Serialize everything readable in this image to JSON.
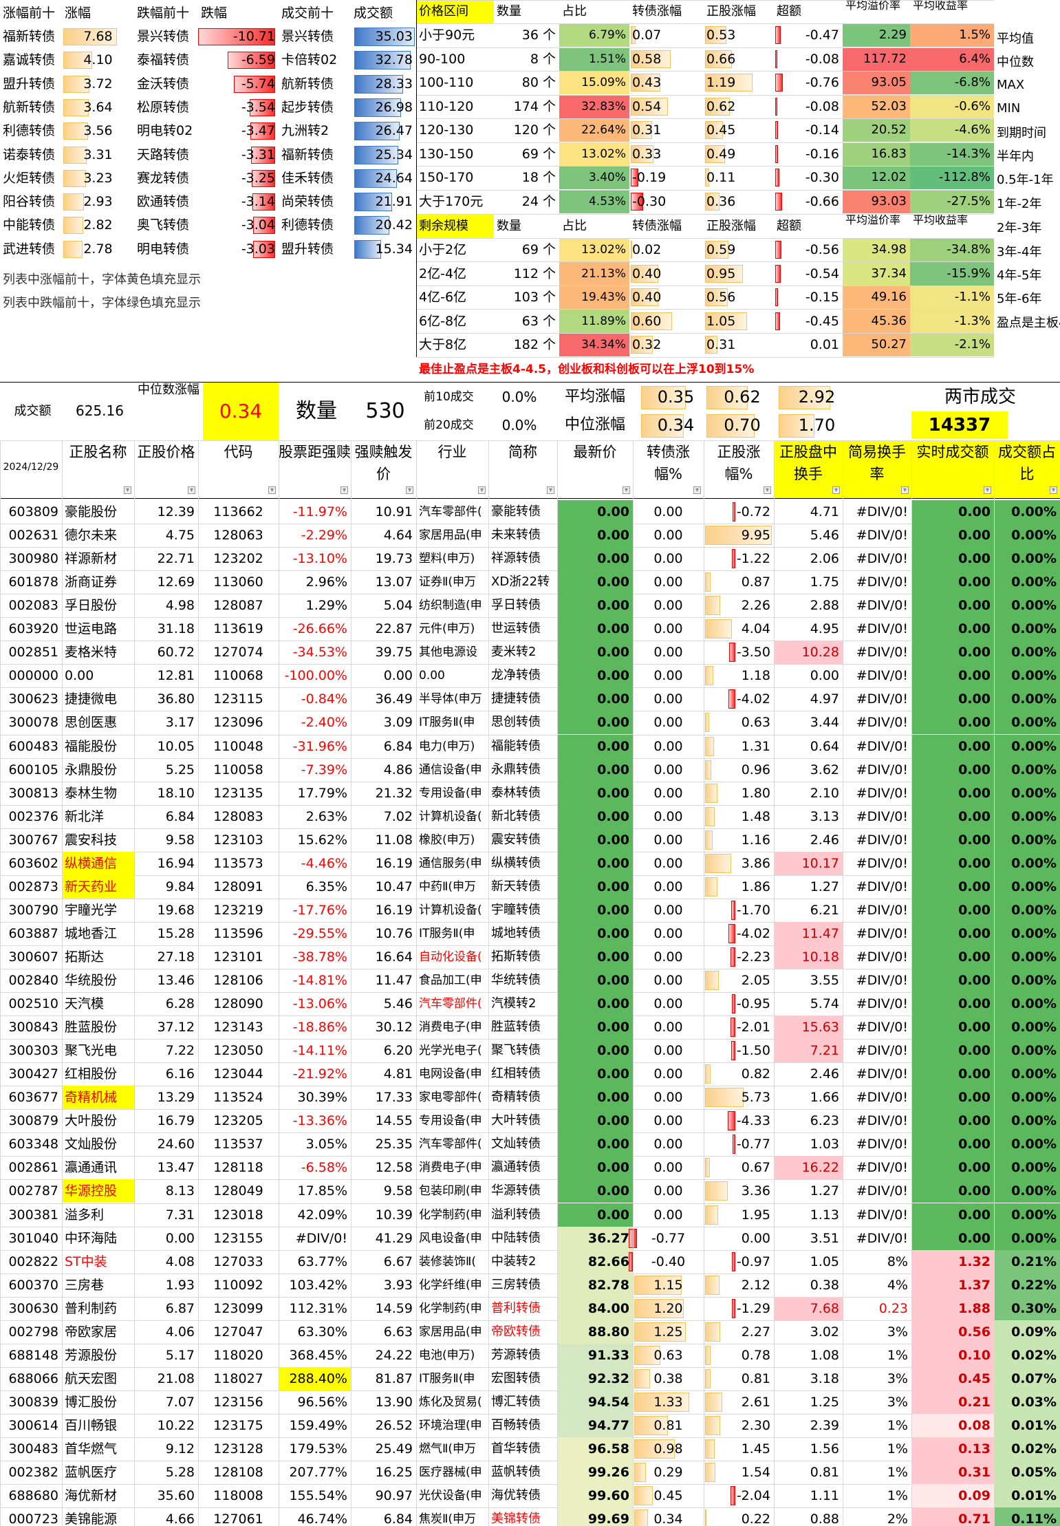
{
  "top_left": {
    "headers": [
      "涨幅前十",
      "涨幅",
      "跌幅前十",
      "跌幅",
      "成交前十",
      "成交额"
    ],
    "gainers": [
      [
        "福新转债",
        "7.68"
      ],
      [
        "嘉诚转债",
        "4.10"
      ],
      [
        "盟升转债",
        "3.72"
      ],
      [
        "航新转债",
        "3.64"
      ],
      [
        "利德转债",
        "3.56"
      ],
      [
        "诺泰转债",
        "3.31"
      ],
      [
        "火炬转债",
        "3.23"
      ],
      [
        "阳谷转债",
        "2.93"
      ],
      [
        "中能转债",
        "2.82"
      ],
      [
        "武进转债",
        "2.78"
      ]
    ],
    "losers": [
      [
        "景兴转债",
        "-10.71"
      ],
      [
        "泰福转债",
        "-6.59"
      ],
      [
        "金沃转债",
        "-5.74"
      ],
      [
        "松原转债",
        "-3.54"
      ],
      [
        "明电转02",
        "-3.47"
      ],
      [
        "天路转债",
        "-3.31"
      ],
      [
        "赛龙转债",
        "-3.25"
      ],
      [
        "欧通转债",
        "-3.14"
      ],
      [
        "奥飞转债",
        "-3.04"
      ],
      [
        "明电转债",
        "-3.03"
      ]
    ],
    "volume": [
      [
        "景兴转债",
        "35.03"
      ],
      [
        "卡倍转02",
        "32.78"
      ],
      [
        "航新转债",
        "28.33"
      ],
      [
        "起步转债",
        "26.98"
      ],
      [
        "九洲转2",
        "26.47"
      ],
      [
        "福新转债",
        "25.34"
      ],
      [
        "佳禾转债",
        "24.64"
      ],
      [
        "尚荣转债",
        "21.91"
      ],
      [
        "利德转债",
        "20.42"
      ],
      [
        "盟升转债",
        "15.34"
      ]
    ],
    "notes": [
      "列表中涨幅前十，字体黄色填充显示",
      "列表中跌幅前十，字体绿色填充显示"
    ]
  },
  "price_table": {
    "headers": [
      "价格区间",
      "数量",
      "占比",
      "转债涨幅",
      "正股涨幅",
      "超额",
      "平均溢价率",
      "平均收益率"
    ],
    "rows": [
      [
        "小于90元",
        "36 个",
        "6.79%",
        "0.07",
        "0.53",
        "-0.47",
        "2.29",
        "1.5%"
      ],
      [
        "90-100",
        "8 个",
        "1.51%",
        "0.58",
        "0.66",
        "-0.08",
        "117.72",
        "6.4%"
      ],
      [
        "100-110",
        "80 个",
        "15.09%",
        "0.43",
        "1.19",
        "-0.76",
        "93.05",
        "-6.8%"
      ],
      [
        "110-120",
        "174 个",
        "32.83%",
        "0.54",
        "0.62",
        "-0.08",
        "52.03",
        "-0.6%"
      ],
      [
        "120-130",
        "120 个",
        "22.64%",
        "0.31",
        "0.45",
        "-0.14",
        "20.52",
        "-4.6%"
      ],
      [
        "130-150",
        "69 个",
        "13.02%",
        "0.33",
        "0.49",
        "-0.16",
        "16.83",
        "-14.3%"
      ],
      [
        "150-170",
        "18 个",
        "3.40%",
        "-0.19",
        "0.11",
        "-0.30",
        "12.02",
        "-112.8%"
      ],
      [
        "大于170元",
        "24 个",
        "4.53%",
        "-0.30",
        "0.36",
        "-0.66",
        "93.03",
        "-27.5%"
      ]
    ]
  },
  "size_table": {
    "headers": [
      "剩余规模",
      "数量",
      "占比",
      "转债涨幅",
      "正股涨幅",
      "超额",
      "平均溢价率",
      "平均收益率"
    ],
    "rows": [
      [
        "小于2亿",
        "69 个",
        "13.02%",
        "0.02",
        "0.59",
        "-0.56",
        "34.98",
        "-34.8%"
      ],
      [
        "2亿-4亿",
        "112 个",
        "21.13%",
        "0.40",
        "0.95",
        "-0.54",
        "37.34",
        "-15.9%"
      ],
      [
        "4亿-6亿",
        "103 个",
        "19.43%",
        "0.40",
        "0.56",
        "-0.15",
        "49.16",
        "-1.1%"
      ],
      [
        "6亿-8亿",
        "63 个",
        "11.89%",
        "0.60",
        "1.05",
        "-0.45",
        "45.36",
        "-1.3%"
      ],
      [
        "大于8亿",
        "182 个",
        "34.34%",
        "0.32",
        "0.31",
        "0.01",
        "50.27",
        "-2.1%"
      ]
    ]
  },
  "side_labels": [
    "平均值",
    "中位数",
    "MAX",
    "MIN",
    "到期时间",
    "半年内",
    "0.5年-1年",
    "1年-2年",
    "2年-3年",
    "3年-4年",
    "4年-5年",
    "5年-6年",
    "盈点是主板4"
  ],
  "note_red": "最佳止盈点是主板4-4.5，创业板和科创板可以在上浮10到15%",
  "summary": {
    "vol_label": "成交额",
    "vol_value": "625.16",
    "median_label": "中位数涨幅",
    "median_value": "0.34",
    "count_label": "数量",
    "count_value": "530",
    "top10_label": "前10成交",
    "top10_value": "0.0%",
    "top20_label": "前20成交",
    "top20_value": "0.0%",
    "avg_label": "平均涨幅",
    "avg_vals": [
      "0.35",
      "0.62",
      "2.92"
    ],
    "mid_label": "中位涨幅",
    "mid_vals": [
      "0.34",
      "0.70",
      "1.70"
    ],
    "market_label": "两市成交",
    "market_value": "14337"
  },
  "main_table": {
    "date": "2024/12/29",
    "headers": [
      "正股名称",
      "正股价格",
      "代码",
      "股票距强赎",
      "强赎触发价",
      "行业",
      "简称",
      "最新价",
      "转债涨幅%",
      "正股涨幅%",
      "正股盘中换手",
      "简易换手率",
      "实时成交额",
      "成交额占比"
    ],
    "rows": [
      [
        "603809",
        "豪能股份",
        "12.39",
        "113662",
        "-11.97%",
        "10.91",
        "汽车零部件(",
        "豪能转债",
        "0.00",
        "0.00",
        "-0.72",
        "4.71",
        "#DIV/0!",
        "0.00",
        "0.00%"
      ],
      [
        "002631",
        "德尔未来",
        "4.75",
        "128063",
        "-2.29%",
        "4.64",
        "家居用品(申",
        "未来转债",
        "0.00",
        "0.00",
        "9.95",
        "5.46",
        "#DIV/0!",
        "0.00",
        "0.00%"
      ],
      [
        "300980",
        "祥源新材",
        "22.71",
        "123202",
        "-13.10%",
        "19.73",
        "塑料(申万)",
        "祥源转债",
        "0.00",
        "0.00",
        "-1.22",
        "2.06",
        "#DIV/0!",
        "0.00",
        "0.00%"
      ],
      [
        "601878",
        "浙商证券",
        "12.69",
        "113060",
        "2.96%",
        "13.07",
        "证券Ⅱ(申万",
        "XD浙22转",
        "0.00",
        "0.00",
        "0.87",
        "1.75",
        "#DIV/0!",
        "0.00",
        "0.00%"
      ],
      [
        "002083",
        "孚日股份",
        "4.98",
        "128087",
        "1.29%",
        "5.04",
        "纺织制造(申",
        "孚日转债",
        "0.00",
        "0.00",
        "2.26",
        "2.88",
        "#DIV/0!",
        "0.00",
        "0.00%"
      ],
      [
        "603920",
        "世运电路",
        "31.18",
        "113619",
        "-26.66%",
        "22.87",
        "元件(申万)",
        "世运转债",
        "0.00",
        "0.00",
        "4.04",
        "4.95",
        "#DIV/0!",
        "0.00",
        "0.00%"
      ],
      [
        "002851",
        "麦格米特",
        "60.72",
        "127074",
        "-34.53%",
        "39.75",
        "其他电源设",
        "麦米转2",
        "0.00",
        "0.00",
        "-3.50",
        "10.28",
        "#DIV/0!",
        "0.00",
        "0.00%"
      ],
      [
        "000000",
        "",
        "0.00",
        "12.81",
        "110068",
        "-100.00%",
        "0.00",
        "0.00",
        "龙净转债",
        "0.00",
        "0.00",
        "1.18",
        "0.00",
        "#DIV/0!",
        "0.00"
      ],
      [
        "300623",
        "捷捷微电",
        "36.80",
        "123115",
        "-0.84%",
        "36.49",
        "半导体(申万",
        "捷捷转债",
        "0.00",
        "0.00",
        "-4.02",
        "4.97",
        "#DIV/0!",
        "0.00",
        "0.00%"
      ],
      [
        "300078",
        "思创医惠",
        "3.17",
        "123096",
        "-2.40%",
        "3.09",
        "IT服务Ⅱ(申",
        "思创转债",
        "0.00",
        "0.00",
        "0.63",
        "3.44",
        "#DIV/0!",
        "0.00",
        "0.00%"
      ],
      [
        "600483",
        "福能股份",
        "10.05",
        "110048",
        "-31.96%",
        "6.84",
        "电力(申万)",
        "福能转债",
        "0.00",
        "0.00",
        "1.31",
        "0.64",
        "#DIV/0!",
        "0.00",
        "0.00%"
      ],
      [
        "600105",
        "永鼎股份",
        "5.25",
        "110058",
        "-7.39%",
        "4.86",
        "通信设备(申",
        "永鼎转债",
        "0.00",
        "0.00",
        "0.96",
        "3.62",
        "#DIV/0!",
        "0.00",
        "0.00%"
      ],
      [
        "300813",
        "泰林生物",
        "18.10",
        "123135",
        "17.79%",
        "21.32",
        "专用设备(申",
        "泰林转债",
        "0.00",
        "0.00",
        "1.80",
        "2.10",
        "#DIV/0!",
        "0.00",
        "0.00%"
      ],
      [
        "002376",
        "新北洋",
        "6.84",
        "128083",
        "2.63%",
        "7.02",
        "计算机设备(",
        "新北转债",
        "0.00",
        "0.00",
        "1.48",
        "3.13",
        "#DIV/0!",
        "0.00",
        "0.00%"
      ],
      [
        "300767",
        "震安科技",
        "9.58",
        "123103",
        "15.62%",
        "11.08",
        "橡胶(申万)",
        "震安转债",
        "0.00",
        "0.00",
        "1.16",
        "2.46",
        "#DIV/0!",
        "0.00",
        "0.00%"
      ],
      [
        "603602",
        "纵横通信",
        "16.94",
        "113573",
        "-4.46%",
        "16.19",
        "通信服务(申",
        "纵横转债",
        "0.00",
        "0.00",
        "3.86",
        "10.17",
        "#DIV/0!",
        "0.00",
        "0.00%"
      ],
      [
        "002873",
        "新天药业",
        "9.84",
        "128091",
        "6.35%",
        "10.47",
        "中药Ⅱ(申万",
        "新天转债",
        "0.00",
        "0.00",
        "1.86",
        "1.27",
        "#DIV/0!",
        "0.00",
        "0.00%"
      ],
      [
        "300790",
        "宇瞳光学",
        "19.68",
        "123219",
        "-17.76%",
        "16.19",
        "计算机设备(",
        "宇瞳转债",
        "0.00",
        "0.00",
        "-1.70",
        "6.21",
        "#DIV/0!",
        "0.00",
        "0.00%"
      ],
      [
        "603887",
        "城地香江",
        "15.28",
        "113596",
        "-29.55%",
        "10.76",
        "IT服务Ⅱ(申",
        "城地转债",
        "0.00",
        "0.00",
        "-4.02",
        "11.47",
        "#DIV/0!",
        "0.00",
        "0.00%"
      ],
      [
        "300607",
        "拓斯达",
        "27.18",
        "123101",
        "-38.78%",
        "16.64",
        "自动化设备(",
        "拓斯转债",
        "0.00",
        "0.00",
        "-2.23",
        "10.18",
        "#DIV/0!",
        "0.00",
        "0.00%"
      ],
      [
        "002840",
        "华统股份",
        "13.46",
        "128106",
        "-14.81%",
        "11.47",
        "食品加工(申",
        "华统转债",
        "0.00",
        "0.00",
        "2.05",
        "3.55",
        "#DIV/0!",
        "0.00",
        "0.00%"
      ],
      [
        "002510",
        "天汽模",
        "6.28",
        "128090",
        "-13.06%",
        "5.46",
        "汽车零部件(",
        "汽模转2",
        "0.00",
        "0.00",
        "-0.95",
        "5.74",
        "#DIV/0!",
        "0.00",
        "0.00%"
      ],
      [
        "300843",
        "胜蓝股份",
        "37.12",
        "123143",
        "-18.86%",
        "30.12",
        "消费电子(申",
        "胜蓝转债",
        "0.00",
        "0.00",
        "-2.01",
        "15.63",
        "#DIV/0!",
        "0.00",
        "0.00%"
      ],
      [
        "300303",
        "聚飞光电",
        "7.22",
        "123050",
        "-14.11%",
        "6.20",
        "光学光电子(",
        "聚飞转债",
        "0.00",
        "0.00",
        "-1.50",
        "7.21",
        "#DIV/0!",
        "0.00",
        "0.00%"
      ],
      [
        "300427",
        "红相股份",
        "6.16",
        "123044",
        "-21.92%",
        "4.81",
        "电网设备(申",
        "红相转债",
        "0.00",
        "0.00",
        "0.82",
        "2.46",
        "#DIV/0!",
        "0.00",
        "0.00%"
      ],
      [
        "603677",
        "奇精机械",
        "13.29",
        "113524",
        "30.39%",
        "17.33",
        "家电零部件(",
        "奇精转债",
        "0.00",
        "0.00",
        "5.73",
        "1.66",
        "#DIV/0!",
        "0.00",
        "0.00%"
      ],
      [
        "300879",
        "大叶股份",
        "16.79",
        "123205",
        "-13.36%",
        "14.55",
        "专用设备(申",
        "大叶转债",
        "0.00",
        "0.00",
        "-4.33",
        "6.23",
        "#DIV/0!",
        "0.00",
        "0.00%"
      ],
      [
        "603348",
        "文灿股份",
        "24.60",
        "113537",
        "3.05%",
        "25.35",
        "汽车零部件(",
        "文灿转债",
        "0.00",
        "0.00",
        "-0.77",
        "1.03",
        "#DIV/0!",
        "0.00",
        "0.00%"
      ],
      [
        "002861",
        "瀛通通讯",
        "13.47",
        "128118",
        "-6.58%",
        "12.58",
        "消费电子(申",
        "瀛通转债",
        "0.00",
        "0.00",
        "0.67",
        "16.22",
        "#DIV/0!",
        "0.00",
        "0.00%"
      ],
      [
        "002787",
        "华源控股",
        "8.13",
        "128049",
        "17.85%",
        "9.58",
        "包装印刷(申",
        "华源转债",
        "0.00",
        "0.00",
        "3.36",
        "1.27",
        "#DIV/0!",
        "0.00",
        "0.00%"
      ],
      [
        "300381",
        "溢多利",
        "7.31",
        "123018",
        "42.09%",
        "10.39",
        "化学制药(申",
        "溢利转债",
        "0.00",
        "0.00",
        "1.95",
        "1.13",
        "#DIV/0!",
        "0.00",
        "0.00%"
      ],
      [
        "301040",
        "中环海陆",
        "0.00",
        "123155",
        "#DIV/0!",
        "41.29",
        "风电设备(申",
        "中陆转债",
        "36.27",
        "-0.77",
        "0.00",
        "3.51",
        "#DIV/0!",
        "0.00",
        "0.00%"
      ],
      [
        "002822",
        "ST中装",
        "4.08",
        "127033",
        "63.77%",
        "6.67",
        "装修装饰Ⅱ(",
        "中装转2",
        "82.66",
        "-0.40",
        "-0.97",
        "1.05",
        "8%",
        "1.32",
        "0.21%"
      ],
      [
        "600370",
        "三房巷",
        "1.93",
        "110092",
        "103.42%",
        "3.93",
        "化学纤维(申",
        "三房转债",
        "82.78",
        "1.15",
        "2.12",
        "0.38",
        "4%",
        "1.37",
        "0.22%"
      ],
      [
        "300630",
        "普利制药",
        "6.87",
        "123099",
        "112.31%",
        "14.59",
        "化学制药(申",
        "普利转债",
        "84.00",
        "1.20",
        "-1.29",
        "7.68",
        "0.23",
        "1.88",
        "0.30%"
      ],
      [
        "002798",
        "帝欧家居",
        "4.06",
        "127047",
        "63.30%",
        "6.63",
        "家居用品(申",
        "帝欧转债",
        "88.80",
        "1.25",
        "2.27",
        "3.02",
        "3%",
        "0.56",
        "0.09%"
      ],
      [
        "688148",
        "芳源股份",
        "5.17",
        "118020",
        "368.45%",
        "24.22",
        "电池(申万)",
        "芳源转债",
        "91.33",
        "0.63",
        "0.78",
        "1.08",
        "1%",
        "0.10",
        "0.02%"
      ],
      [
        "688066",
        "航天宏图",
        "21.08",
        "118027",
        "288.40%",
        "81.87",
        "IT服务Ⅱ(申",
        "宏图转债",
        "92.32",
        "0.38",
        "0.81",
        "3.18",
        "3%",
        "0.45",
        "0.07%"
      ],
      [
        "300839",
        "博汇股份",
        "7.07",
        "123156",
        "96.56%",
        "13.90",
        "炼化及贸易(",
        "博汇转债",
        "94.54",
        "1.33",
        "2.61",
        "1.25",
        "3%",
        "0.21",
        "0.03%"
      ],
      [
        "300614",
        "百川畅银",
        "10.22",
        "123175",
        "159.49%",
        "26.52",
        "环境治理(申",
        "百畅转债",
        "94.77",
        "0.81",
        "2.30",
        "2.39",
        "1%",
        "0.08",
        "0.01%"
      ],
      [
        "300483",
        "首华燃气",
        "9.12",
        "123128",
        "179.53%",
        "25.49",
        "燃气Ⅱ(申万",
        "首华转债",
        "96.58",
        "0.98",
        "1.45",
        "1.56",
        "1%",
        "0.13",
        "0.02%"
      ],
      [
        "002382",
        "蓝帆医疗",
        "5.28",
        "128108",
        "207.77%",
        "16.25",
        "医疗器械(申",
        "蓝帆转债",
        "99.26",
        "0.29",
        "1.54",
        "0.81",
        "1%",
        "0.31",
        "0.05%"
      ],
      [
        "688680",
        "海优新材",
        "35.60",
        "118008",
        "155.54%",
        "90.97",
        "光伏设备(申",
        "海优转债",
        "99.60",
        "0.45",
        "-2.04",
        "1.11",
        "1%",
        "0.09",
        "0.01%"
      ],
      [
        "000723",
        "美锦能源",
        "4.66",
        "127061",
        "46.74%",
        "6.84",
        "焦炭Ⅱ(申万",
        "美锦转债",
        "99.69",
        "0.34",
        "0.22",
        "0.88",
        "2%",
        "0.71",
        "0.11%"
      ]
    ]
  },
  "colors": {
    "green": "#5cb85c",
    "green_light": "#c6e6b8",
    "yellow": "#ffff00",
    "red": "#ff0000",
    "pink": "#ffc7ce",
    "orange": "#f8a86a",
    "blue": "#3f78c8"
  }
}
